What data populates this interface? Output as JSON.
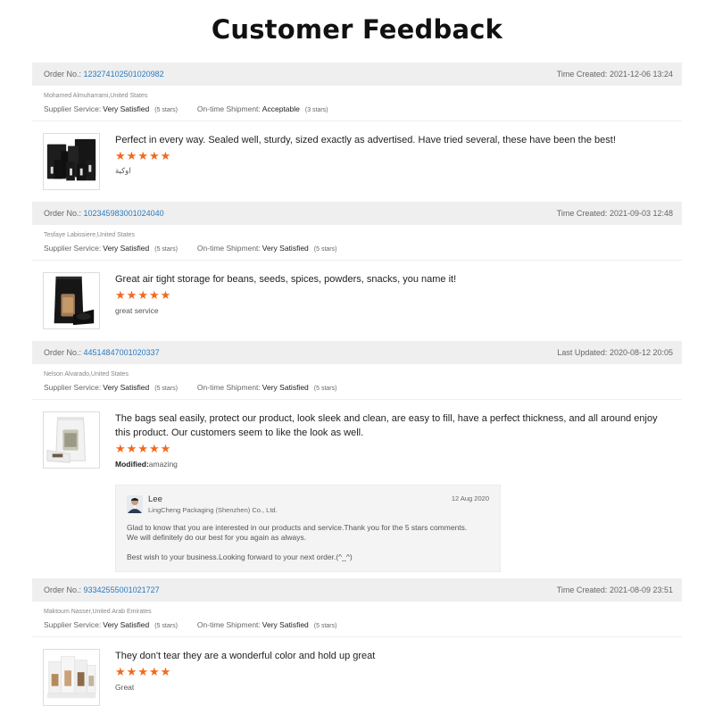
{
  "page": {
    "title": "Customer Feedback"
  },
  "star_color": "#f26a1b",
  "reviews": [
    {
      "order_label": "Order No.:",
      "order_no": "123274102501020982",
      "time_label": "Time Created:",
      "time": "2021-12-06 13:24",
      "buyer": "Mohamed Almuharrami,United States",
      "supplier_label": "Supplier Service:",
      "supplier_value": "Very Satisfied",
      "supplier_stars": "(5 stars)",
      "shipment_label": "On-time Shipment:",
      "shipment_value": "Acceptable",
      "shipment_stars": "(3 stars)",
      "comment": "Perfect in every way. Sealed well, sturdy, sized exactly as advertised. Have tried several, these have been the best!",
      "rating": 5,
      "sub_comment": "اوكية",
      "thumb_icon": "black-bags-image"
    },
    {
      "order_label": "Order No.:",
      "order_no": "102345983001024040",
      "time_label": "Time Created:",
      "time": "2021-09-03 12:48",
      "buyer": "Tesfaye Labissiere,United States",
      "supplier_label": "Supplier Service:",
      "supplier_value": "Very Satisfied",
      "supplier_stars": "(5 stars)",
      "shipment_label": "On-time Shipment:",
      "shipment_value": "Very Satisfied",
      "shipment_stars": "(5 stars)",
      "comment": "Great air tight storage for beans, seeds, spices, powders, snacks, you name it!",
      "rating": 5,
      "sub_comment": "great service",
      "thumb_icon": "black-window-bag-image"
    },
    {
      "order_label": "Order No.:",
      "order_no": "44514847001020337",
      "time_label": "Last Updated:",
      "time": "2020-08-12 20:05",
      "buyer": "Nelson Alvarado,United States",
      "supplier_label": "Supplier Service:",
      "supplier_value": "Very Satisfied",
      "supplier_stars": "(5 stars)",
      "shipment_label": "On-time Shipment:",
      "shipment_value": "Very Satisfied",
      "shipment_stars": "(5 stars)",
      "comment": "The bags seal easily, protect our product, look sleek and clean, are easy to fill, have a perfect thickness, and all around enjoy this product. Our customers seem to like the look as well.",
      "rating": 5,
      "modified_label": "Modified:",
      "sub_comment": "amazing",
      "thumb_icon": "white-window-bag-image",
      "reply": {
        "name": "Lee",
        "company": "LingCheng Packaging (Shenzhen) Co., Ltd.",
        "date": "12 Aug 2020",
        "message_1": "Glad to know that you are interested in our products and service.Thank you for the 5 stars comments.",
        "message_2": "We will definitely do our best for you again as always.",
        "message_3": "Best wish to your business.Looking forward to your next order.(^_^)"
      }
    },
    {
      "order_label": "Order No.:",
      "order_no": "93342555001021727",
      "time_label": "Time Created:",
      "time": "2021-08-09 23:51",
      "buyer": "Maktoum Nasser,United Arab Emirates",
      "supplier_label": "Supplier Service:",
      "supplier_value": "Very Satisfied",
      "supplier_stars": "(5 stars)",
      "shipment_label": "On-time Shipment:",
      "shipment_value": "Very Satisfied",
      "shipment_stars": "(5 stars)",
      "comment": "They don't tear they are a wonderful color and hold up great",
      "rating": 5,
      "sub_comment": "Great",
      "thumb_icon": "mixed-bags-image"
    }
  ]
}
